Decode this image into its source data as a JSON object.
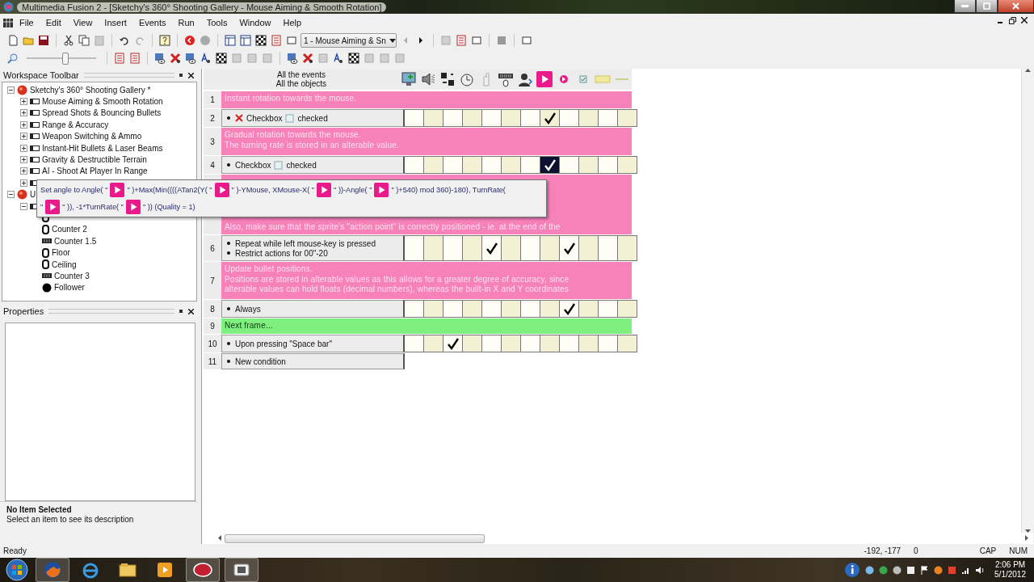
{
  "window": {
    "title": "Multimedia Fusion 2 - [Sketchy's 360° Shooting Gallery - Mouse Aiming & Smooth Rotation]"
  },
  "menu": [
    "File",
    "Edit",
    "View",
    "Insert",
    "Events",
    "Run",
    "Tools",
    "Window",
    "Help"
  ],
  "frame_dropdown": {
    "value": "1 - Mouse Aiming & Sn"
  },
  "zoom_slider": {
    "level": 0.55
  },
  "workspace": {
    "title": "Workspace Toolbar",
    "tree": [
      {
        "label": "Sketchy's 360° Shooting Gallery *",
        "kind": "app",
        "expanded": true,
        "children": [
          {
            "label": "Mouse Aiming & Smooth Rotation",
            "kind": "frame",
            "expanded": false
          },
          {
            "label": "Spread Shots & Bouncing Bullets",
            "kind": "frame",
            "expanded": false
          },
          {
            "label": "Range & Accuracy",
            "kind": "frame",
            "expanded": false
          },
          {
            "label": "Weapon Switching & Ammo",
            "kind": "frame",
            "expanded": false
          },
          {
            "label": "Instant-Hit Bullets & Laser Beams",
            "kind": "frame",
            "expanded": false
          },
          {
            "label": "Gravity & Destructible Terrain",
            "kind": "frame",
            "expanded": false
          },
          {
            "label": "AI - Shoot At Player In Range",
            "kind": "frame",
            "expanded": false
          },
          {
            "kind": "frame",
            "expanded": false
          }
        ]
      },
      {
        "label": "U",
        "kind": "app",
        "expanded": true,
        "children": [
          {
            "kind": "frame",
            "expanded": true,
            "children": [
              {
                "kind": "counter"
              },
              {
                "label": "Counter 2",
                "kind": "counter"
              },
              {
                "label": "Counter 1.5",
                "kind": "bar"
              },
              {
                "label": "Floor",
                "kind": "counter"
              },
              {
                "label": "Ceiling",
                "kind": "counter"
              },
              {
                "label": "Counter 3",
                "kind": "bar"
              },
              {
                "label": "Follower",
                "kind": "ball"
              }
            ]
          }
        ]
      }
    ]
  },
  "properties": {
    "title": "Properties",
    "info_title": "No Item Selected",
    "info_text": "Select an item to see its description"
  },
  "event_header": {
    "line1": "All the events",
    "line2": "All the objects"
  },
  "events": [
    {
      "number": "1",
      "kind": "comment",
      "lines": [
        "Instant rotation towards the mouse."
      ]
    },
    {
      "number": "2",
      "kind": "event",
      "conditions": [
        {
          "negated": true,
          "object": "Checkbox",
          "text": "checked"
        }
      ],
      "cells": [
        {
          "checked": false,
          "selected": false
        },
        {
          "checked": false,
          "selected": false
        },
        {
          "checked": false,
          "selected": false
        },
        {
          "checked": false,
          "selected": false
        },
        {
          "checked": false,
          "selected": false
        },
        {
          "checked": false,
          "selected": false
        },
        {
          "checked": false,
          "selected": false
        },
        {
          "checked": true,
          "selected": false
        },
        {
          "checked": false,
          "selected": false
        },
        {
          "checked": false,
          "selected": false
        },
        {
          "checked": false,
          "selected": false
        },
        {
          "checked": false,
          "selected": false
        }
      ]
    },
    {
      "number": "3",
      "kind": "comment",
      "lines": [
        "Gradual rotation towards the mouse.",
        "The turning rate is stored in an alterable value."
      ]
    },
    {
      "number": "4",
      "kind": "event",
      "conditions": [
        {
          "negated": false,
          "object": "Checkbox",
          "text": "checked"
        }
      ],
      "cells": [
        {
          "checked": false,
          "selected": false
        },
        {
          "checked": false,
          "selected": false
        },
        {
          "checked": false,
          "selected": false
        },
        {
          "checked": false,
          "selected": false
        },
        {
          "checked": false,
          "selected": false
        },
        {
          "checked": false,
          "selected": false
        },
        {
          "checked": false,
          "selected": false
        },
        {
          "checked": true,
          "selected": true
        },
        {
          "checked": false,
          "selected": false
        },
        {
          "checked": false,
          "selected": false
        },
        {
          "checked": false,
          "selected": false
        },
        {
          "checked": false,
          "selected": false
        }
      ]
    },
    {
      "kind": "comment",
      "tall": true,
      "lines": [
        "Also, make sure that the sprite's \"action point\" is correctly positioned - ie. at the end of the"
      ]
    },
    {
      "number": "6",
      "kind": "event",
      "conditions": [
        {
          "negated": false,
          "text": "Repeat while left mouse-key is pressed"
        },
        {
          "negated": false,
          "text": "Restrict actions for 00\"-20"
        }
      ],
      "cells": [
        {
          "checked": false,
          "selected": false
        },
        {
          "checked": false,
          "selected": false
        },
        {
          "checked": false,
          "selected": false
        },
        {
          "checked": false,
          "selected": false
        },
        {
          "checked": true,
          "selected": false
        },
        {
          "checked": false,
          "selected": false
        },
        {
          "checked": false,
          "selected": false
        },
        {
          "checked": false,
          "selected": false
        },
        {
          "checked": true,
          "selected": false
        },
        {
          "checked": false,
          "selected": false
        },
        {
          "checked": false,
          "selected": false
        },
        {
          "checked": false,
          "selected": false
        }
      ]
    },
    {
      "number": "7",
      "kind": "comment",
      "lines": [
        "Update bullet positions.",
        "Positions are stored in alterable values as this allows for a greater degree of accuracy, since",
        "alterable values can hold floats (decimal numbers), whereas the built-in X and Y coordinates"
      ]
    },
    {
      "number": "8",
      "kind": "event",
      "conditions": [
        {
          "negated": false,
          "text": "Always"
        }
      ],
      "cells": [
        {
          "checked": false,
          "selected": false
        },
        {
          "checked": false,
          "selected": false
        },
        {
          "checked": false,
          "selected": false
        },
        {
          "checked": false,
          "selected": false
        },
        {
          "checked": false,
          "selected": false
        },
        {
          "checked": false,
          "selected": false
        },
        {
          "checked": false,
          "selected": false
        },
        {
          "checked": false,
          "selected": false
        },
        {
          "checked": true,
          "selected": false
        },
        {
          "checked": false,
          "selected": false
        },
        {
          "checked": false,
          "selected": false
        },
        {
          "checked": false,
          "selected": false
        }
      ]
    },
    {
      "number": "9",
      "kind": "group",
      "lines": [
        "Next frame..."
      ]
    },
    {
      "number": "10",
      "kind": "event",
      "conditions": [
        {
          "negated": false,
          "text": "Upon pressing \"Space bar\""
        }
      ],
      "cells": [
        {
          "checked": false,
          "selected": false
        },
        {
          "checked": false,
          "selected": false
        },
        {
          "checked": true,
          "selected": false
        },
        {
          "checked": false,
          "selected": false
        },
        {
          "checked": false,
          "selected": false
        },
        {
          "checked": false,
          "selected": false
        },
        {
          "checked": false,
          "selected": false
        },
        {
          "checked": false,
          "selected": false
        },
        {
          "checked": false,
          "selected": false
        },
        {
          "checked": false,
          "selected": false
        },
        {
          "checked": false,
          "selected": false
        },
        {
          "checked": false,
          "selected": false
        }
      ]
    },
    {
      "number": "11",
      "kind": "new",
      "conditions": [
        {
          "negated": false,
          "text": "New condition"
        }
      ]
    }
  ],
  "tooltip": {
    "lines": [
      [
        {
          "kind": "text",
          "text": "Set angle to Angle( \""
        },
        {
          "kind": "object"
        },
        {
          "kind": "text",
          "text": "\" )+Max(Min((((ATan2(Y( \""
        },
        {
          "kind": "object"
        },
        {
          "kind": "text",
          "text": "\" )-YMouse, XMouse-X( \""
        },
        {
          "kind": "object"
        },
        {
          "kind": "text",
          "text": "\" ))-Angle( \""
        },
        {
          "kind": "object"
        },
        {
          "kind": "text",
          "text": "\" )+540) mod 360)-180), TurnRate("
        }
      ],
      [
        {
          "kind": "text",
          "text": "\""
        },
        {
          "kind": "object"
        },
        {
          "kind": "text",
          "text": "\" )), -1*TurnRate( \""
        },
        {
          "kind": "object"
        },
        {
          "kind": "text",
          "text": "\" )) (Quality = 1)"
        }
      ]
    ]
  },
  "status_bar": {
    "message": "Ready",
    "coords": "-192, -177",
    "layer": "0",
    "caps": "CAP",
    "num": "NUM"
  },
  "taskbar": {
    "time": "2:06 PM",
    "date": "5/1/2012"
  }
}
